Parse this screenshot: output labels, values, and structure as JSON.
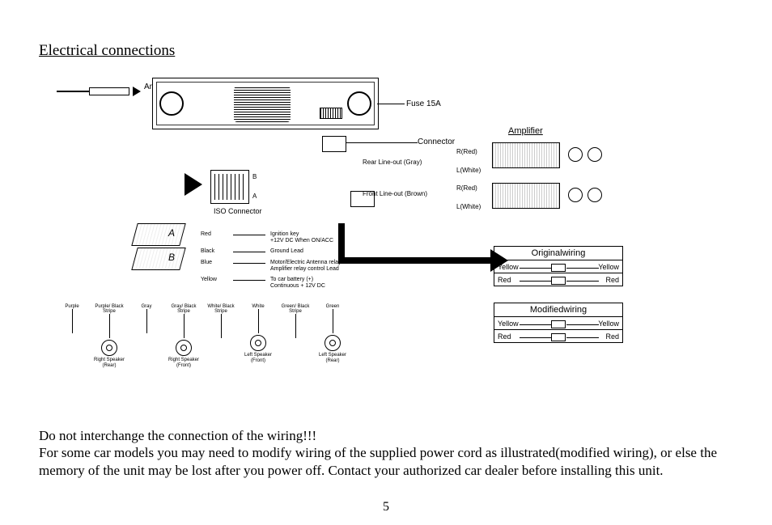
{
  "title": "Electrical connections",
  "antenna": "Antenna",
  "fuse": "Fuse 15A",
  "connector": "Connector",
  "rear_lineout": "Rear Line-out (Gray)",
  "front_lineout": "Front Line-out (Brown)",
  "r_red": "R(Red)",
  "l_white": "L(White)",
  "amplifier": "Amplifier",
  "iso_connector": "ISO Connector",
  "iso_b": "B",
  "iso_a": "A",
  "wires": [
    {
      "color": "Red",
      "desc": "Ignition key\n+12V DC When ON/ACC"
    },
    {
      "color": "Black",
      "desc": "Ground Lead"
    },
    {
      "color": "Blue",
      "desc": "Motor/Electric Antenna relay control Lead\nAmplifier relay control Lead"
    },
    {
      "color": "Yellow",
      "desc": "To car battery (+)\nContinuous + 12V DC"
    }
  ],
  "speakers": [
    {
      "color": "Purple",
      "name": ""
    },
    {
      "color": "Purple/ Black Stripe",
      "name": "Right Speaker (Rear)"
    },
    {
      "color": "Gray",
      "name": ""
    },
    {
      "color": "Gray/ Black Stripe",
      "name": "Right Speaker (Front)"
    },
    {
      "color": "White/ Black Stripe",
      "name": ""
    },
    {
      "color": "White",
      "name": "Left Speaker (Front)"
    },
    {
      "color": "Green/ Black Stripe",
      "name": ""
    },
    {
      "color": "Green",
      "name": "Left Speaker (Rear)"
    }
  ],
  "original_wiring": {
    "title": "Originalwiring",
    "rows": [
      {
        "left": "Yellow",
        "right": "Yellow"
      },
      {
        "left": "Red",
        "right": "Red"
      }
    ]
  },
  "modified_wiring": {
    "title": "Modifiedwiring",
    "rows": [
      {
        "left": "Yellow",
        "right": "Yellow"
      },
      {
        "left": "Red",
        "right": "Red"
      }
    ]
  },
  "warning": "Do not interchange the connection of the wiring!!!",
  "note": "For some car models you may need to modify wiring of the supplied power cord as illustrated(modified wiring), or else the memory of the unit may be lost after you power off. Contact your authorized car dealer before installing this unit.",
  "page_number": "5"
}
